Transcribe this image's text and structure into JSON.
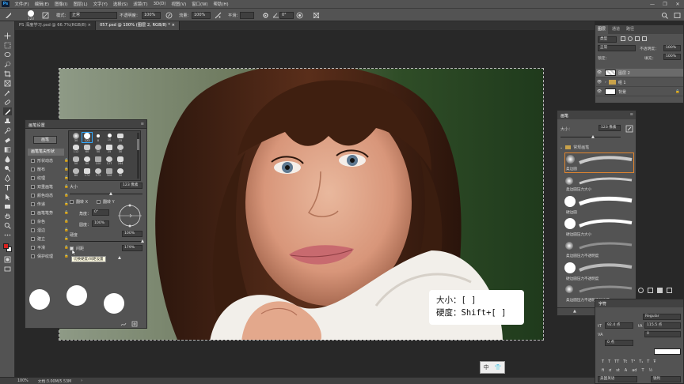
{
  "menubar": {
    "logo": "Ps",
    "items": [
      "文件(F)",
      "编辑(E)",
      "图像(I)",
      "图层(L)",
      "文字(Y)",
      "选择(S)",
      "滤镜(T)",
      "3D(D)",
      "视图(V)",
      "窗口(W)",
      "帮助(H)"
    ],
    "window_controls": [
      "—",
      "❐",
      "✕"
    ]
  },
  "options": {
    "brush_size": "123",
    "mode_label": "模式：",
    "mode_value": "正常",
    "opacity_label": "不透明度：",
    "opacity_value": "100%",
    "flow_label": "流量：",
    "flow_value": "100%",
    "smooth_label": "平滑：",
    "angle_value": "0°"
  },
  "tabs": [
    {
      "label": "PS 深度学习.psd @ 66.7%(RGB/8) ×",
      "active": false
    },
    {
      "label": "057.psd @ 100% (图层 2, RGB/8) * ×",
      "active": true
    }
  ],
  "brush_settings": {
    "title": "画笔设置",
    "presets_button": "画笔",
    "tip_shape_label": "画笔笔尖形状",
    "options": [
      {
        "label": "形状动态",
        "checked": false
      },
      {
        "label": "散布",
        "checked": false
      },
      {
        "label": "纹理",
        "checked": false
      },
      {
        "label": "双重画笔",
        "checked": false
      },
      {
        "label": "颜色动态",
        "checked": false
      },
      {
        "label": "传递",
        "checked": false
      },
      {
        "label": "画笔笔势",
        "checked": false
      },
      {
        "label": "杂色",
        "checked": false
      },
      {
        "label": "湿边",
        "checked": false
      },
      {
        "label": "建立",
        "checked": false
      },
      {
        "label": "平滑",
        "checked": false
      },
      {
        "label": "保护纹理",
        "checked": false
      }
    ],
    "preset_sizes": [
      "30",
      "123",
      "8",
      "10",
      "25",
      "112",
      "60",
      "50",
      "25",
      "30",
      "50",
      "60",
      "100",
      "127",
      "284",
      "80",
      "174",
      "175",
      "306",
      "50"
    ],
    "size_label": "大小",
    "size_value": "123 像素",
    "flip_x": "翻转 X",
    "flip_y": "翻转 Y",
    "angle_label": "角度：",
    "angle_value": "0°",
    "roundness_label": "圆度：",
    "roundness_value": "100%",
    "hardness_label": "硬度",
    "hardness_value": "100%",
    "spacing_label": "间距",
    "spacing_value": "179%",
    "tooltip": "切换硬度/间距设置",
    "footer_icons": [
      "brush-preview-icon",
      "new-brush-icon"
    ]
  },
  "layers": {
    "tabs": [
      "图层",
      "通道",
      "路径"
    ],
    "kind_label": "类型",
    "blend_mode": "正常",
    "opacity_label": "不透明度：",
    "opacity_value": "100%",
    "lock_label": "锁定：",
    "fill_label": "填充：",
    "fill_value": "100%",
    "rows": [
      {
        "name": "图层 2",
        "selected": true
      },
      {
        "name": "组 1",
        "selected": false
      },
      {
        "name": "背景",
        "selected": false
      }
    ]
  },
  "brushes": {
    "title": "画笔",
    "size_label": "大小：",
    "size_value": "123 像素",
    "group_name": "常规画笔",
    "items": [
      "柔边圆",
      "柔边圆压力大小",
      "硬边圆",
      "硬边圆压力大小",
      "柔边圆压力不透明度",
      "硬边圆压力不透明度",
      "柔边圆压力不透明度和流量"
    ]
  },
  "character": {
    "title": "字符",
    "style": "Regular",
    "size_value": "92.4 点",
    "leading_value": "115.5 点",
    "tracking_value": "0",
    "kerning_value": "0 点",
    "language": "美国英语",
    "aa": "锐利"
  },
  "shortcut_box": {
    "line1": "大小：[ ]",
    "line2": "硬度：Shift+[ ]"
  },
  "status": {
    "zoom": "100%",
    "doc": "文档:3.00M/5.53M"
  },
  "ime": {
    "label": "中"
  },
  "colors": {
    "accent": "#31a8ff",
    "panel": "#535353",
    "dark": "#282828"
  }
}
